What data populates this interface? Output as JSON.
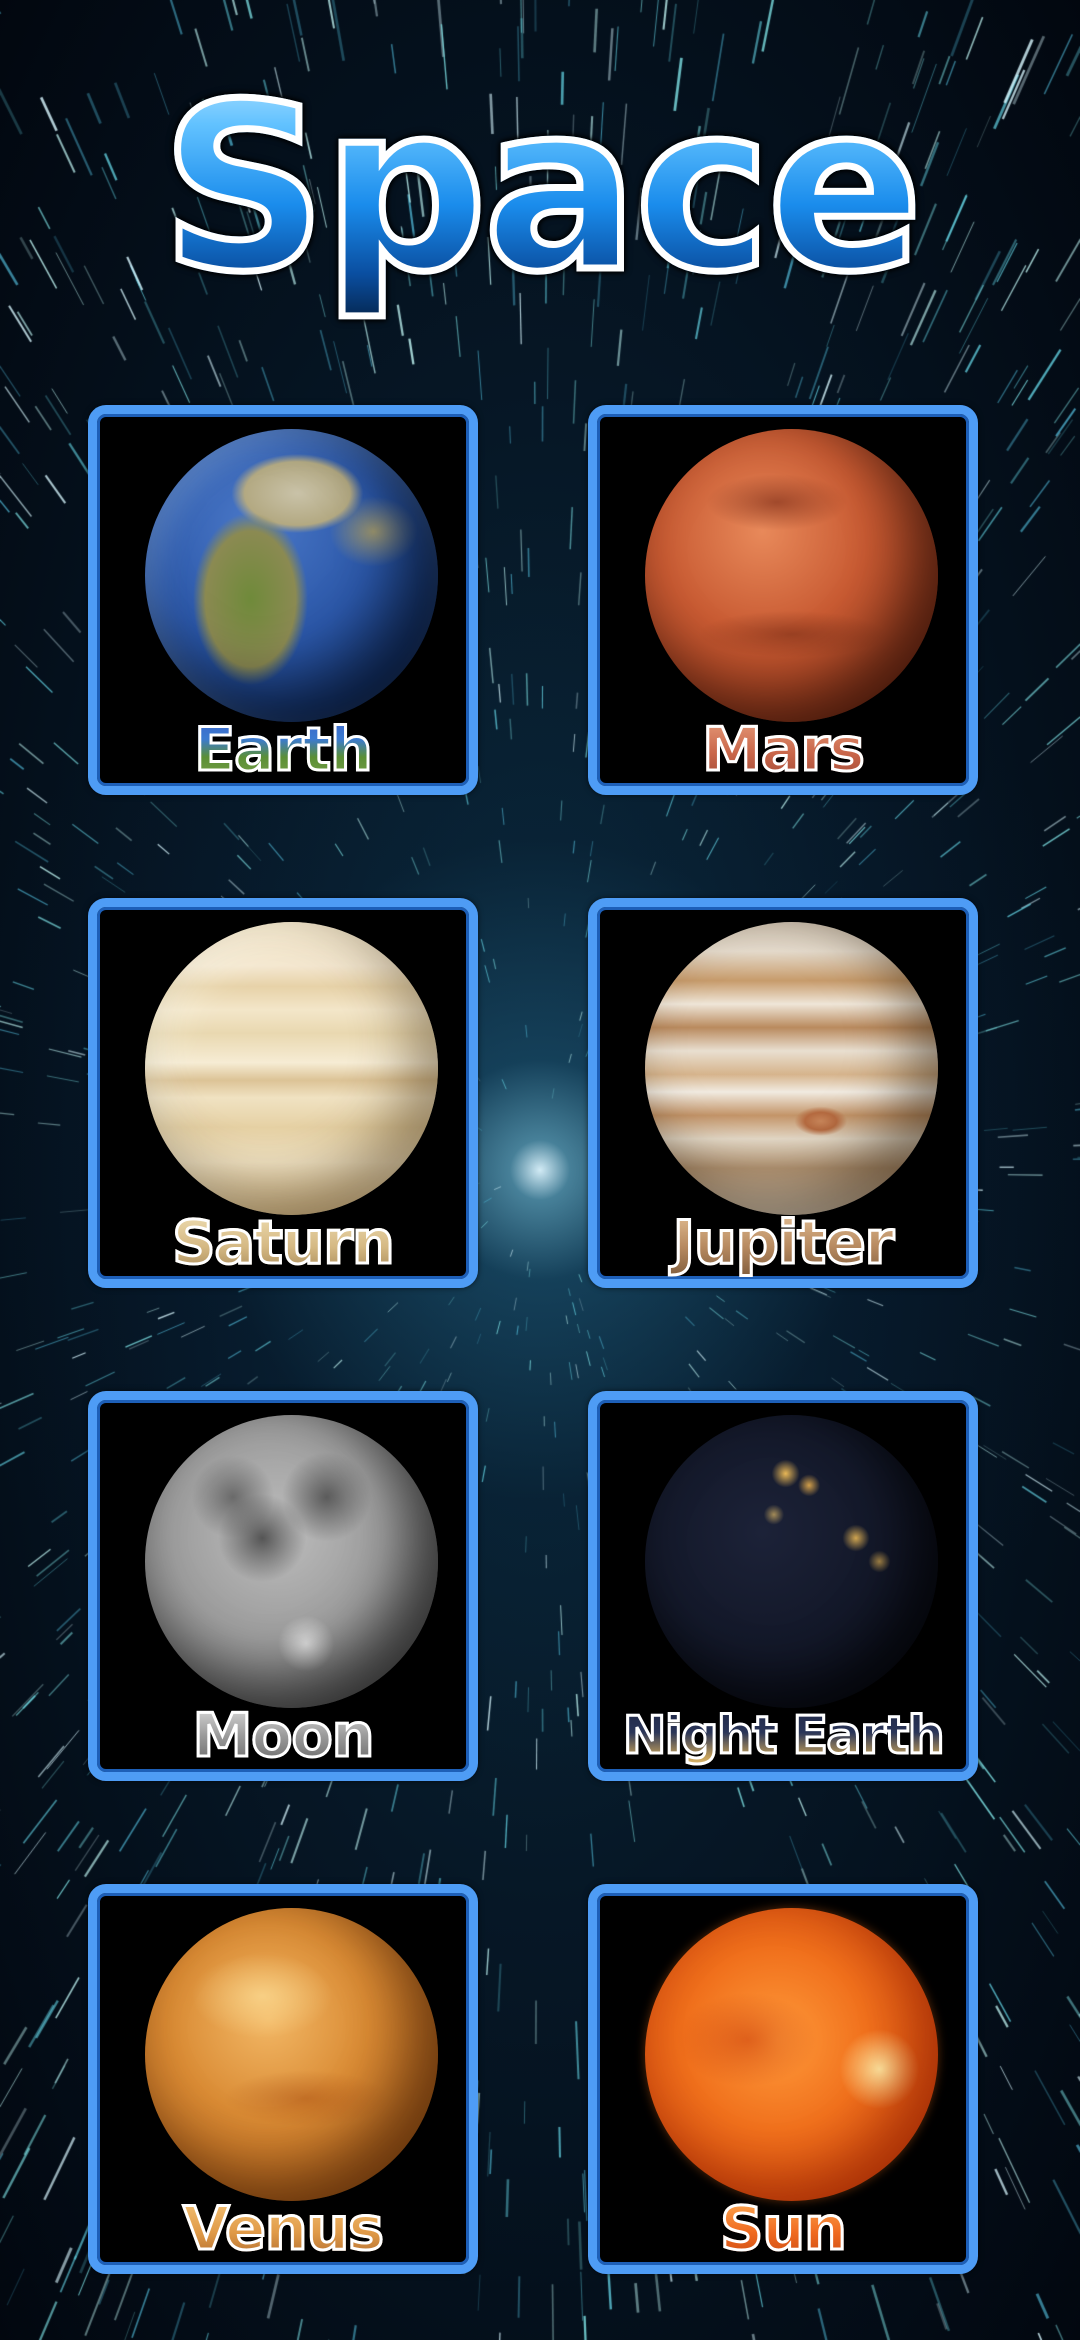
{
  "app": {
    "title": "Space"
  },
  "cards": [
    {
      "id": "earth",
      "label": "Earth",
      "icon": "earth-planet-icon"
    },
    {
      "id": "mars",
      "label": "Mars",
      "icon": "mars-planet-icon"
    },
    {
      "id": "saturn",
      "label": "Saturn",
      "icon": "saturn-planet-icon"
    },
    {
      "id": "jupiter",
      "label": "Jupiter",
      "icon": "jupiter-planet-icon"
    },
    {
      "id": "moon",
      "label": "Moon",
      "icon": "moon-icon"
    },
    {
      "id": "night-earth",
      "label": "Night Earth",
      "icon": "night-earth-icon"
    },
    {
      "id": "venus",
      "label": "Venus",
      "icon": "venus-planet-icon"
    },
    {
      "id": "sun",
      "label": "Sun",
      "icon": "sun-icon"
    }
  ],
  "colors": {
    "card_border": "#4e9cf5",
    "card_background": "#000000",
    "title_blue": "#1a8cec",
    "background": "#020812"
  }
}
